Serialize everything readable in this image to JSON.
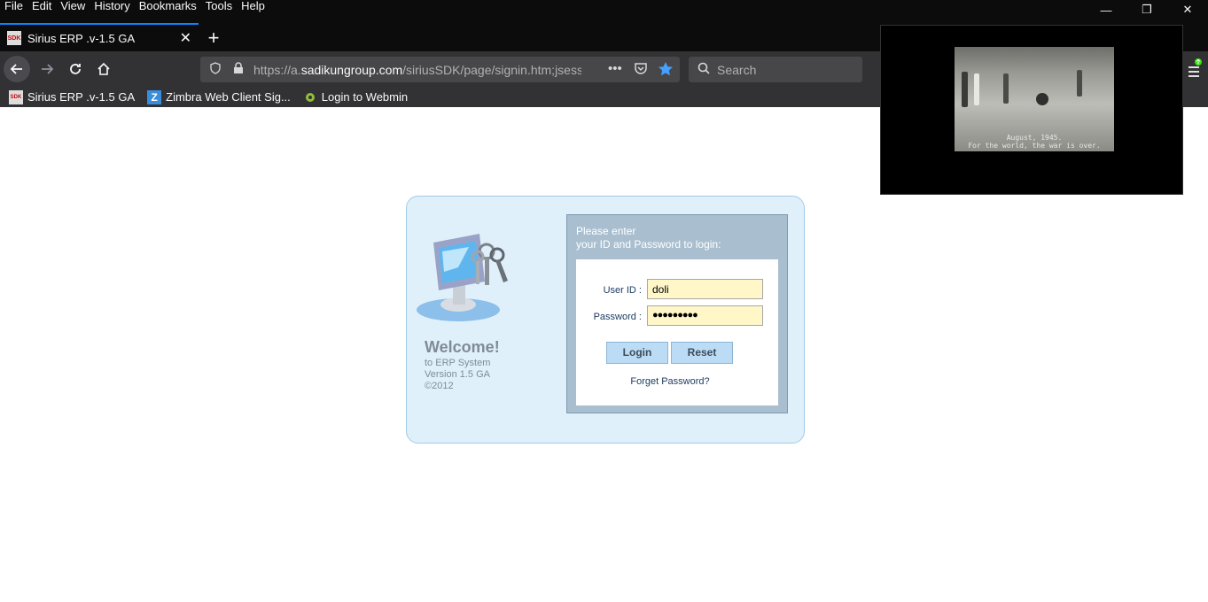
{
  "menubar": {
    "items": [
      "File",
      "Edit",
      "View",
      "History",
      "Bookmarks",
      "Tools",
      "Help"
    ]
  },
  "window_controls": {
    "minimize": "—",
    "restore": "❐",
    "close": "✕"
  },
  "tab": {
    "favicon_text": "SDK",
    "title": "Sirius ERP .v-1.5 GA",
    "close": "✕",
    "new_tab": "+"
  },
  "navbar": {
    "url_prefix": "https://a.",
    "url_domain": "sadikungroup.com",
    "url_path": "/siriusSDK/page/signin.htm;jsess",
    "search_placeholder": "Search"
  },
  "bookmarks": [
    {
      "label": "Sirius ERP .v-1.5 GA",
      "icon": "sdk-favicon"
    },
    {
      "label": "Zimbra Web Client Sig...",
      "icon": "zimbra-icon"
    },
    {
      "label": "Login to Webmin",
      "icon": "webmin-icon"
    }
  ],
  "pip": {
    "caption_line1": "August, 1945.",
    "caption_line2": "For the world, the war is over."
  },
  "welcome": {
    "title": "Welcome!",
    "line1": "to ERP System",
    "line2": "Version 1.5 GA",
    "line3": "©2012"
  },
  "form": {
    "intro_line1": "Please enter",
    "intro_line2": "your ID and Password to login:",
    "user_label": "User ID :",
    "user_value": "doli",
    "password_label": "Password :",
    "password_value": "●●●●●●●●●",
    "login_label": "Login",
    "reset_label": "Reset",
    "forget_label": "Forget Password?"
  },
  "colors": {
    "accent": "#0a84ff",
    "panel_bg": "#e0f0fb",
    "input_bg": "#fff7c8",
    "button_bg": "#bcdcf6"
  }
}
